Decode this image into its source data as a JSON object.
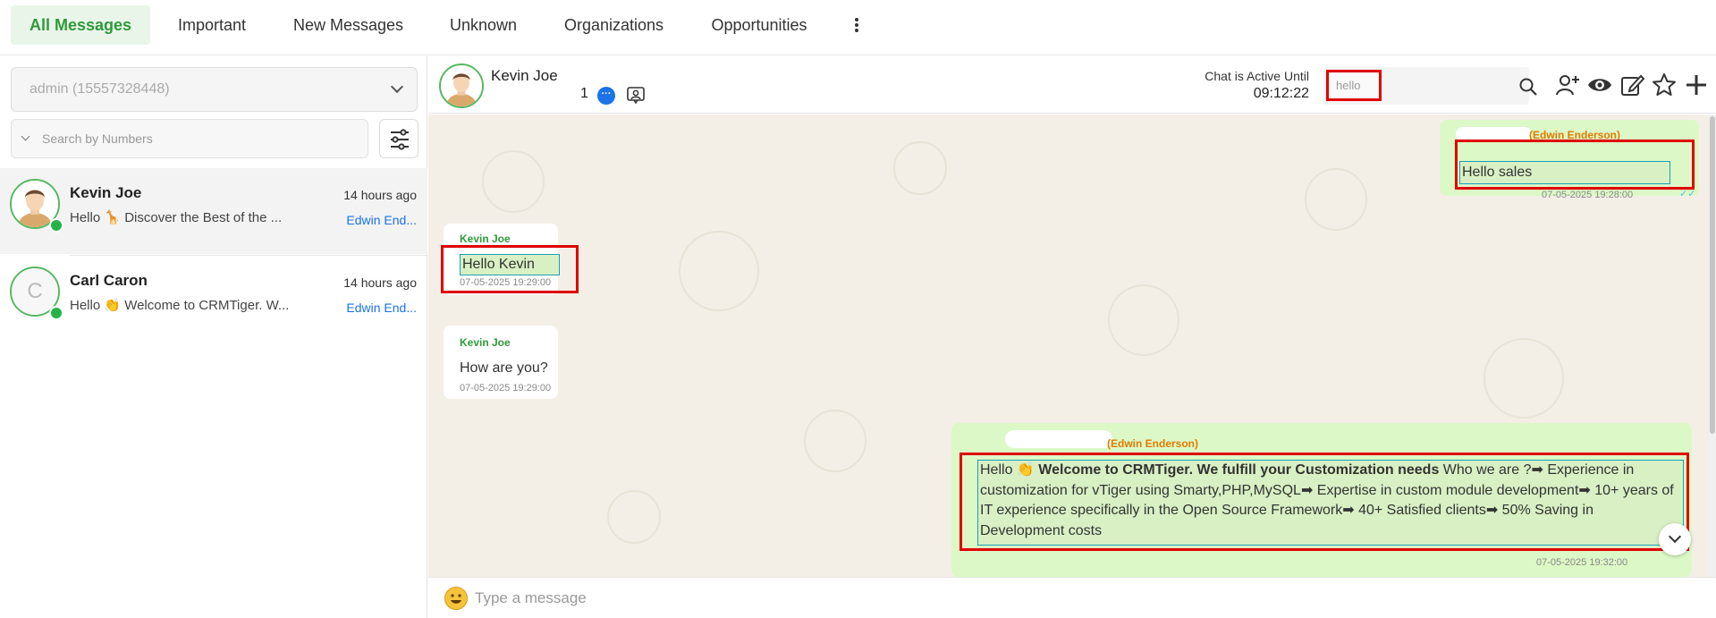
{
  "tabs": [
    {
      "label": "All Messages"
    },
    {
      "label": "Important"
    },
    {
      "label": "New Messages"
    },
    {
      "label": "Unknown"
    },
    {
      "label": "Organizations"
    },
    {
      "label": "Opportunities"
    }
  ],
  "sidebar": {
    "account_select": "admin (15557328448)",
    "search_placeholder": "Search by Numbers",
    "contacts": [
      {
        "name": "Kevin Joe",
        "time": "14 hours ago",
        "preview": "Hello 🦒 Discover the Best of the ...",
        "agent": "Edwin End..."
      },
      {
        "name": "Carl Caron",
        "initial": "C",
        "time": "14 hours ago",
        "preview": "Hello 👏 Welcome to CRMTiger. W...",
        "agent": "Edwin End..."
      }
    ]
  },
  "header": {
    "contact_name": "Kevin Joe",
    "unread_count": "1",
    "active_label": "Chat is Active Until",
    "active_time": "09:12:22",
    "search_value": "hello"
  },
  "messages": [
    {
      "direction": "out",
      "sender": "(Edwin Enderson)",
      "text": "Hello sales",
      "time": "07-05-2025 19:28:00"
    },
    {
      "direction": "in",
      "sender": "Kevin Joe",
      "text": "Hello Kevin",
      "time": "07-05-2025 19:29:00"
    },
    {
      "direction": "in",
      "sender": "Kevin Joe",
      "text": "How are you?",
      "time": "07-05-2025 19:29:00"
    },
    {
      "direction": "out",
      "sender": "(Edwin Enderson)",
      "text_prefix": "Hello 👏 ",
      "text_bold": "Welcome to CRMTiger. We fulfill your Customization needs",
      "text_rest": " Who we are ?➡ Experience in customization for vTiger using Smarty,PHP,MySQL➡ Expertise in custom module development➡ 10+ years of IT experience specifically in the Open Source Framework➡ 40+ Satisfied clients➡ 50% Saving in Development costs",
      "time": "07-05-2025 19:32:00"
    }
  ],
  "composer": {
    "placeholder": "Type a message"
  },
  "colors": {
    "accent_green": "#2e9a3a",
    "highlight_red": "#e00000",
    "link_blue": "#1a73e8",
    "outgoing_bubble": "#dcf8c6",
    "chat_background": "#f3efe6"
  },
  "icons": [
    "kebab-menu-icon",
    "chevron-down-icon",
    "filter-icon",
    "whatsapp-icon",
    "chat-bubble-icon",
    "contact-card-icon",
    "search-icon",
    "add-user-icon",
    "eye-icon",
    "edit-icon",
    "star-icon",
    "plus-icon",
    "emoji-icon",
    "double-check-icon"
  ]
}
